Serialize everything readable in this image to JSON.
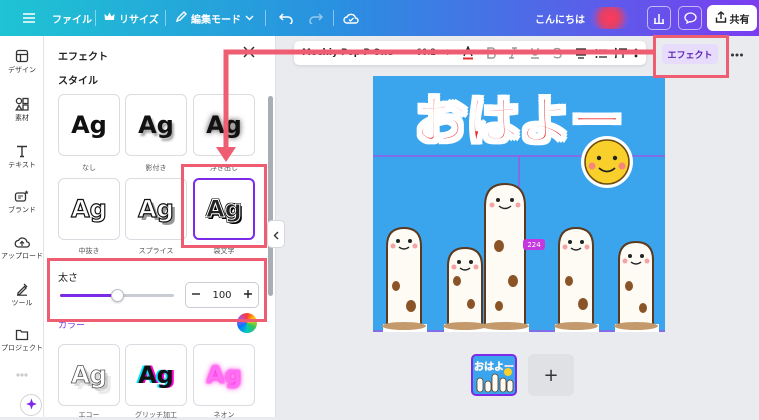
{
  "header": {
    "file": "ファイル",
    "resize": "リサイズ",
    "edit_mode": "編集モード",
    "greeting": "こんにちは",
    "share": "共有"
  },
  "rail": [
    {
      "label": "デザイン",
      "icon": "design-icon"
    },
    {
      "label": "素材",
      "icon": "elements-icon"
    },
    {
      "label": "テキスト",
      "icon": "text-icon"
    },
    {
      "label": "ブランド",
      "icon": "brand-icon"
    },
    {
      "label": "アップロード",
      "icon": "upload-icon"
    },
    {
      "label": "ツール",
      "icon": "tools-icon"
    },
    {
      "label": "プロジェクト",
      "icon": "projects-icon"
    }
  ],
  "panel": {
    "title": "エフェクト",
    "style_title": "スタイル",
    "styles": [
      {
        "name": "なし",
        "sample": "Ag"
      },
      {
        "name": "影付き",
        "sample": "Ag"
      },
      {
        "name": "浮き出し",
        "sample": "Ag"
      },
      {
        "name": "中抜き",
        "sample": "Ag"
      },
      {
        "name": "スプライス",
        "sample": "Ag"
      },
      {
        "name": "袋文字",
        "sample": "Ag"
      }
    ],
    "thickness_label": "太さ",
    "thickness_value": "100",
    "thickness_fraction": 0.5,
    "color_label": "カラー",
    "more_styles": [
      {
        "name": "エコー",
        "sample": "Ag"
      },
      {
        "name": "グリッチ加工",
        "sample": "Ag"
      },
      {
        "name": "ネオン",
        "sample": "Ag"
      }
    ]
  },
  "text_toolbar": {
    "font": "Mochiy Pop P One",
    "size": "60.2",
    "minus": "-",
    "plus": "+",
    "effect_button": "エフェクト"
  },
  "canvas": {
    "headline": "おはよー",
    "badge": "224",
    "background": "#3aa5ec",
    "headline_color": "#e8292f"
  },
  "pages": {
    "thumb_text": "おはよー",
    "add": "+"
  },
  "colors": {
    "accent": "#7d2ae8",
    "highlight": "#ee5d72"
  }
}
